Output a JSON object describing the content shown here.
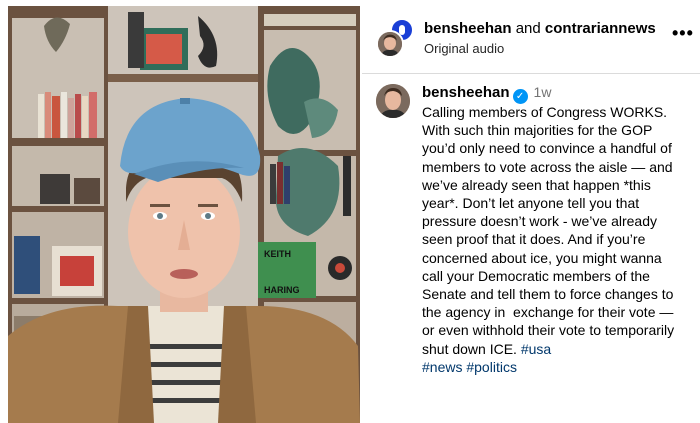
{
  "header": {
    "user1": "bensheehan",
    "joiner": " and ",
    "user2": "contrariannews",
    "audio": "Original audio"
  },
  "post": {
    "username": "bensheehan",
    "verified_icon": "verified-badge-icon",
    "time": "1w",
    "caption": "Calling members of Congress WORKS. With such thin majorities for the GOP you’d only need to convince a handful of members to vote across the aisle — and we’ve already seen that happen *this year*. Don’t let anyone tell you that pressure doesn’t work - we’ve already seen proof that it does. And if you’re concerned about ice, you might wanna call your Democratic members of the Senate and tell them to force changes to the agency in  exchange for their vote — or even withhold their vote to temporarily shut down ICE. ",
    "hashtags": [
      "#usa",
      "#news",
      "#politics"
    ]
  },
  "video": {
    "book_spine_text": "KEITH HARING"
  },
  "colors": {
    "link": "#00376b",
    "verified": "#0095f6",
    "divider": "#dbdbdb",
    "secondary_text": "#737373"
  }
}
